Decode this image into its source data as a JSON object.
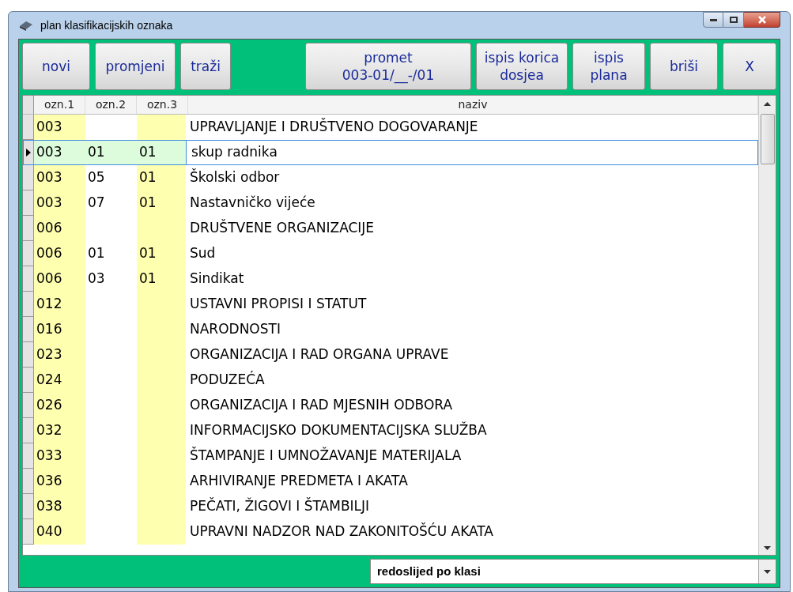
{
  "window": {
    "title": "plan klasifikacijskih oznaka"
  },
  "toolbar": {
    "left_buttons": [
      "novi",
      "promjeni",
      "traži"
    ],
    "right_buttons": [
      {
        "lines": [
          "promet",
          "003-01/__-/01"
        ]
      },
      {
        "lines": [
          "ispis korica",
          "dosjea"
        ]
      },
      {
        "lines": [
          "ispis",
          "plana"
        ]
      },
      {
        "lines": [
          "briši"
        ]
      },
      {
        "lines": [
          "X"
        ]
      }
    ]
  },
  "table": {
    "columns": [
      "ozn.1",
      "ozn.2",
      "ozn.3",
      "naziv"
    ],
    "rows": [
      {
        "ozn1": "003",
        "ozn2": "",
        "ozn3": "",
        "naziv": "UPRAVLJANJE I DRUŠTVENO DOGOVARANJE",
        "selected": false
      },
      {
        "ozn1": "003",
        "ozn2": "01",
        "ozn3": "01",
        "naziv": "skup radnika",
        "selected": true
      },
      {
        "ozn1": "003",
        "ozn2": "05",
        "ozn3": "01",
        "naziv": "Školski odbor",
        "selected": false
      },
      {
        "ozn1": "003",
        "ozn2": "07",
        "ozn3": "01",
        "naziv": "Nastavničko vijeće",
        "selected": false
      },
      {
        "ozn1": "006",
        "ozn2": "",
        "ozn3": "",
        "naziv": "DRUŠTVENE ORGANIZACIJE",
        "selected": false
      },
      {
        "ozn1": "006",
        "ozn2": "01",
        "ozn3": "01",
        "naziv": "Sud",
        "selected": false
      },
      {
        "ozn1": "006",
        "ozn2": "03",
        "ozn3": "01",
        "naziv": "Sindikat",
        "selected": false
      },
      {
        "ozn1": "012",
        "ozn2": "",
        "ozn3": "",
        "naziv": "USTAVNI PROPISI I STATUT",
        "selected": false
      },
      {
        "ozn1": "016",
        "ozn2": "",
        "ozn3": "",
        "naziv": "NARODNOSTI",
        "selected": false
      },
      {
        "ozn1": "023",
        "ozn2": "",
        "ozn3": "",
        "naziv": "ORGANIZACIJA I RAD ORGANA UPRAVE",
        "selected": false
      },
      {
        "ozn1": "024",
        "ozn2": "",
        "ozn3": "",
        "naziv": "PODUZEĆA",
        "selected": false
      },
      {
        "ozn1": "026",
        "ozn2": "",
        "ozn3": "",
        "naziv": "ORGANIZACIJA I RAD MJESNIH ODBORA",
        "selected": false
      },
      {
        "ozn1": "032",
        "ozn2": "",
        "ozn3": "",
        "naziv": "INFORMACIJSKO DOKUMENTACIJSKA SLUŽBA",
        "selected": false
      },
      {
        "ozn1": "033",
        "ozn2": "",
        "ozn3": "",
        "naziv": "ŠTAMPANJE I UMNOŽAVANJE MATERIJALA",
        "selected": false
      },
      {
        "ozn1": "036",
        "ozn2": "",
        "ozn3": "",
        "naziv": "ARHIVIRANJE PREDMETA I AKATA",
        "selected": false
      },
      {
        "ozn1": "038",
        "ozn2": "",
        "ozn3": "",
        "naziv": "PEČATI, ŽIGOVI I ŠTAMBILJI",
        "selected": false
      },
      {
        "ozn1": "040",
        "ozn2": "",
        "ozn3": "",
        "naziv": "UPRAVNI NADZOR NAD ZAKONITOŠĆU AKATA",
        "selected": false
      }
    ]
  },
  "sort_select": {
    "value": "redoslijed po klasi"
  }
}
